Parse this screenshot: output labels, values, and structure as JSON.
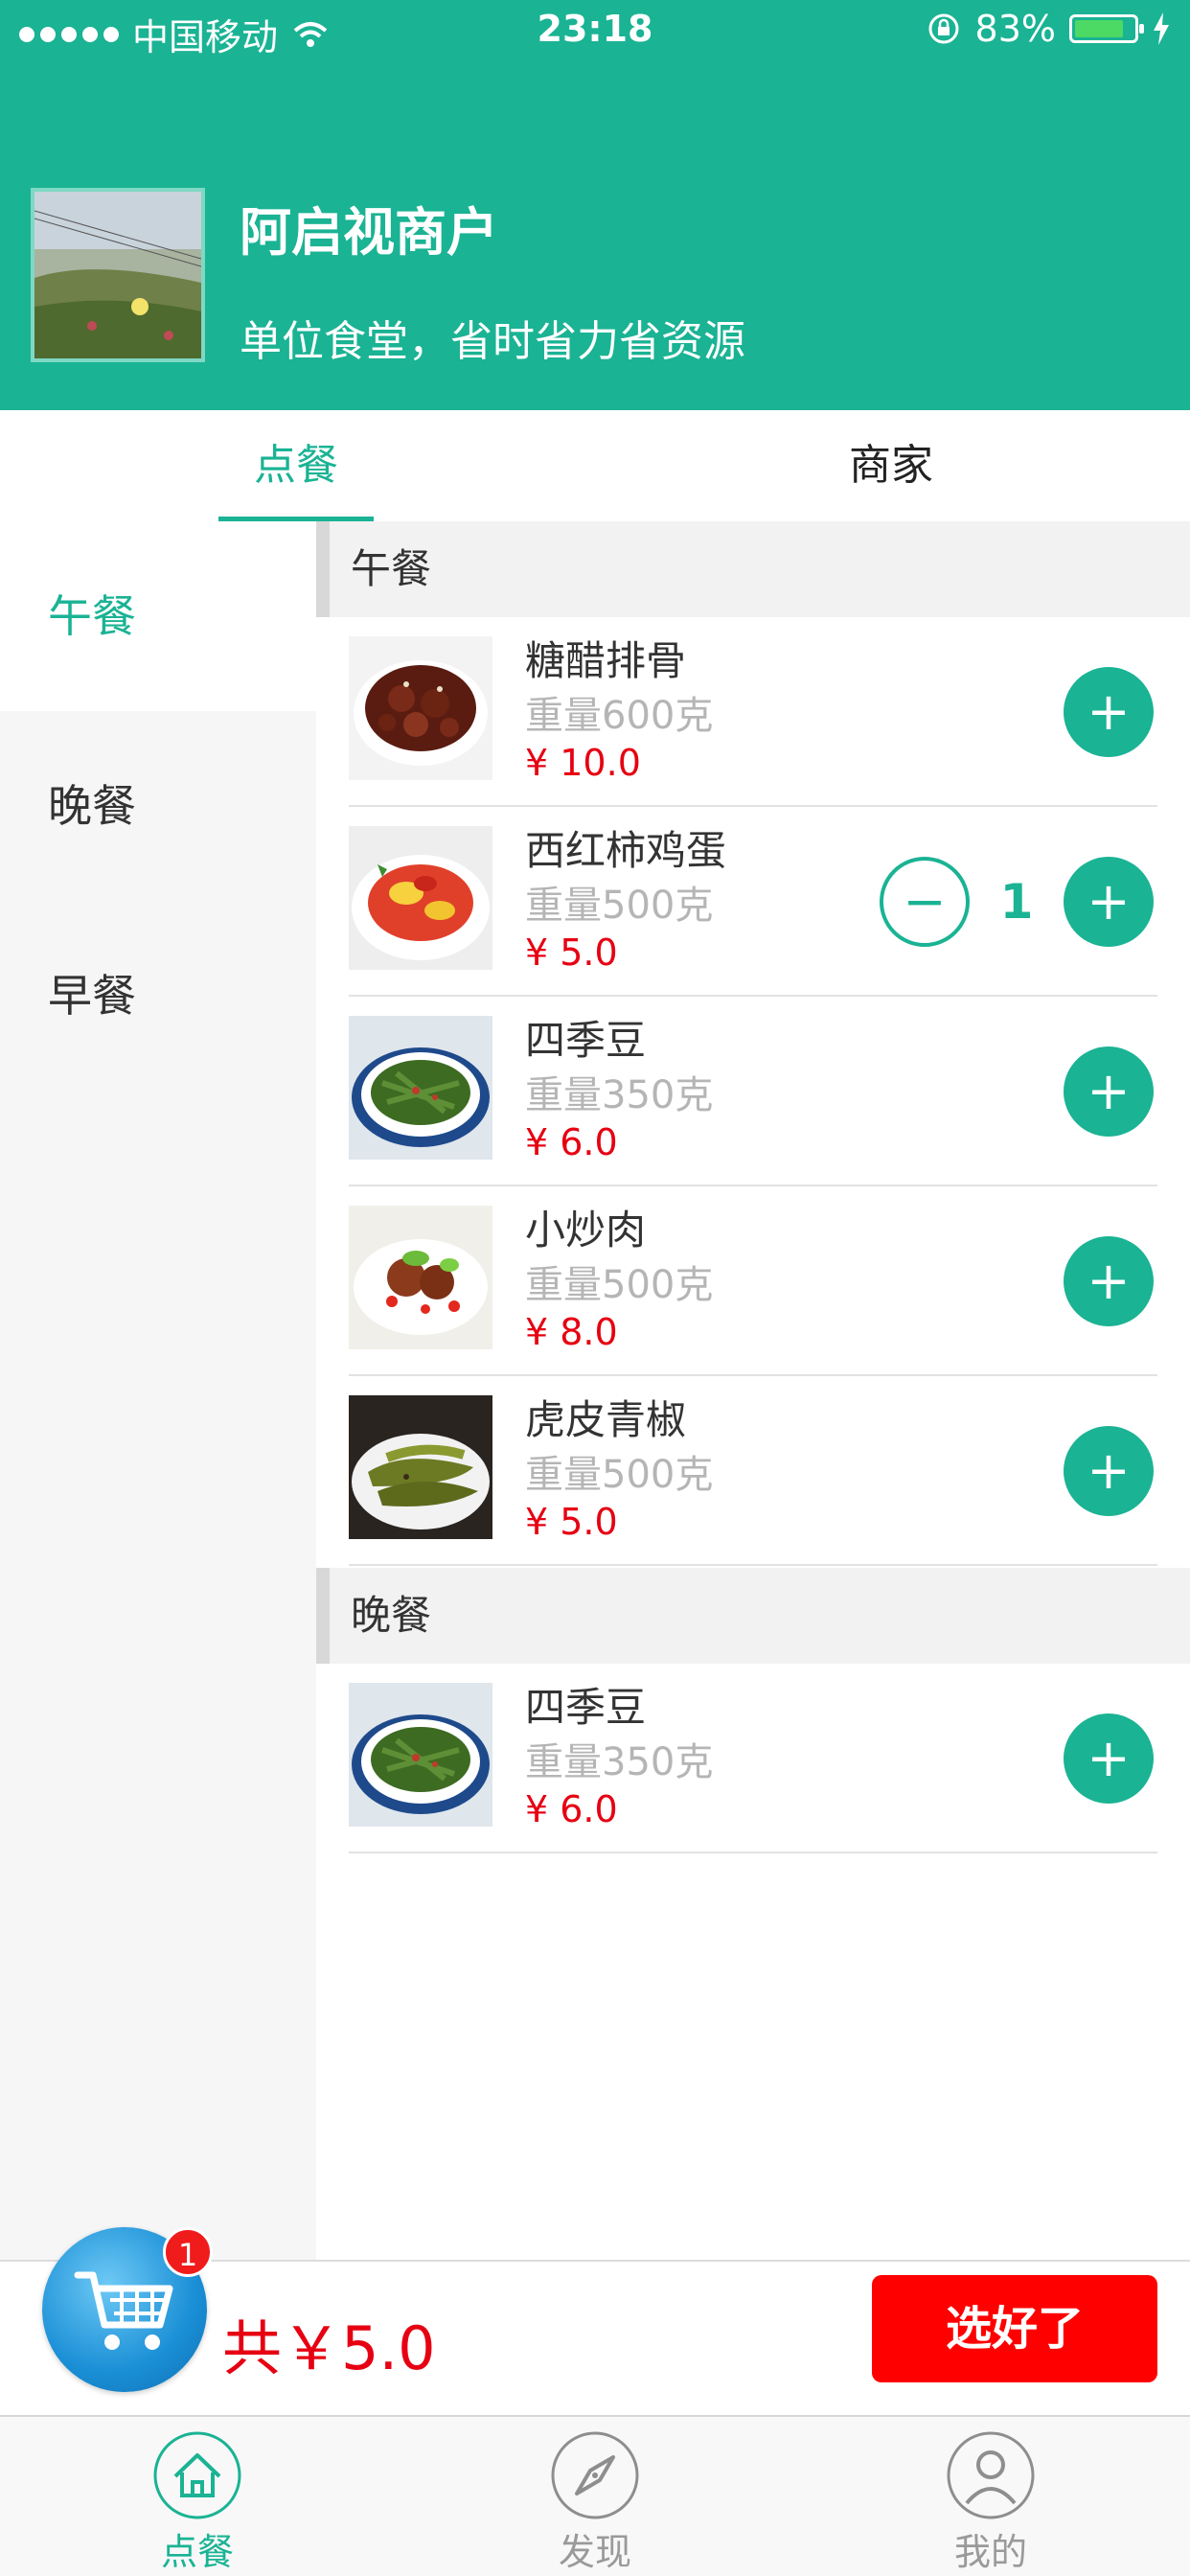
{
  "status_bar": {
    "carrier": "中国移动",
    "time": "23:18",
    "battery": "83%",
    "battery_level": 0.83
  },
  "shop": {
    "name": "阿启视商户",
    "description": "单位食堂，省时省力省资源"
  },
  "tabs": [
    {
      "label": "点餐",
      "active": true
    },
    {
      "label": "商家",
      "active": false
    }
  ],
  "categories": [
    {
      "label": "午餐",
      "active": true
    },
    {
      "label": "晚餐",
      "active": false
    },
    {
      "label": "早餐",
      "active": false
    }
  ],
  "sections": [
    {
      "title": "午餐",
      "items": [
        {
          "name": "糖醋排骨",
          "weight": "重量600克",
          "price": "¥ 10.0",
          "qty": ""
        },
        {
          "name": "西红柿鸡蛋",
          "weight": "重量500克",
          "price": "¥ 5.0",
          "qty": "1"
        },
        {
          "name": "四季豆",
          "weight": "重量350克",
          "price": "¥ 6.0",
          "qty": ""
        },
        {
          "name": "小炒肉",
          "weight": "重量500克",
          "price": "¥ 8.0",
          "qty": ""
        },
        {
          "name": "虎皮青椒",
          "weight": "重量500克",
          "price": "¥ 5.0",
          "qty": ""
        }
      ]
    },
    {
      "title": "晚餐",
      "items": [
        {
          "name": "四季豆",
          "weight": "重量350克",
          "price": "¥ 6.0",
          "qty": ""
        }
      ]
    }
  ],
  "cart": {
    "badge": "1",
    "total": "共￥5.0",
    "confirm_label": "选好了"
  },
  "bottom_nav": [
    {
      "label": "点餐",
      "icon": "home-icon",
      "active": true
    },
    {
      "label": "发现",
      "icon": "compass-icon",
      "active": false
    },
    {
      "label": "我的",
      "icon": "user-icon",
      "active": false
    }
  ],
  "colors": {
    "brand": "#1ab394",
    "price": "#e60012",
    "confirm": "#ff0000"
  }
}
